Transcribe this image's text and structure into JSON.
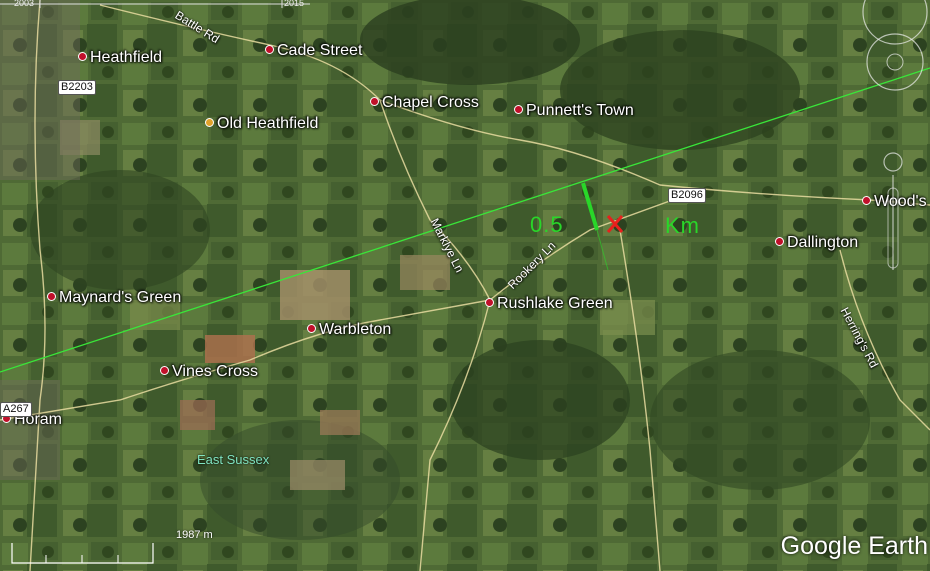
{
  "timeline": {
    "year_start": "2003",
    "year_end": "2015"
  },
  "places": [
    {
      "id": "heathfield",
      "label": "Heathfield"
    },
    {
      "id": "cade-street",
      "label": "Cade Street"
    },
    {
      "id": "chapel-cross",
      "label": "Chapel Cross"
    },
    {
      "id": "punnetts-town",
      "label": "Punnett's Town"
    },
    {
      "id": "old-heathfield",
      "label": "Old Heathfield"
    },
    {
      "id": "woods",
      "label": "Wood's"
    },
    {
      "id": "dallington",
      "label": "Dallington"
    },
    {
      "id": "maynards-green",
      "label": "Maynard's Green"
    },
    {
      "id": "rushlake-green",
      "label": "Rushlake Green"
    },
    {
      "id": "warbleton",
      "label": "Warbleton"
    },
    {
      "id": "vines-cross",
      "label": "Vines Cross"
    },
    {
      "id": "horam",
      "label": "Horam"
    }
  ],
  "roads": {
    "battle_rd": "Battle Rd",
    "marklye_ln": "Marklye Ln",
    "rookery_ln": "Rookery Ln",
    "herrings_rd": "Herring's Rd",
    "b2203": "B2203",
    "b2096": "B2096",
    "a267": "A267"
  },
  "region_label": "East Sussex",
  "measurement": {
    "value": "0.5",
    "unit": "Km"
  },
  "scale_bar": {
    "label": "1987 m"
  },
  "branding": "Google Earth",
  "colors": {
    "measure_green": "#29d629",
    "marker_red": "#e8201c",
    "place_dot": "#c0102a"
  }
}
